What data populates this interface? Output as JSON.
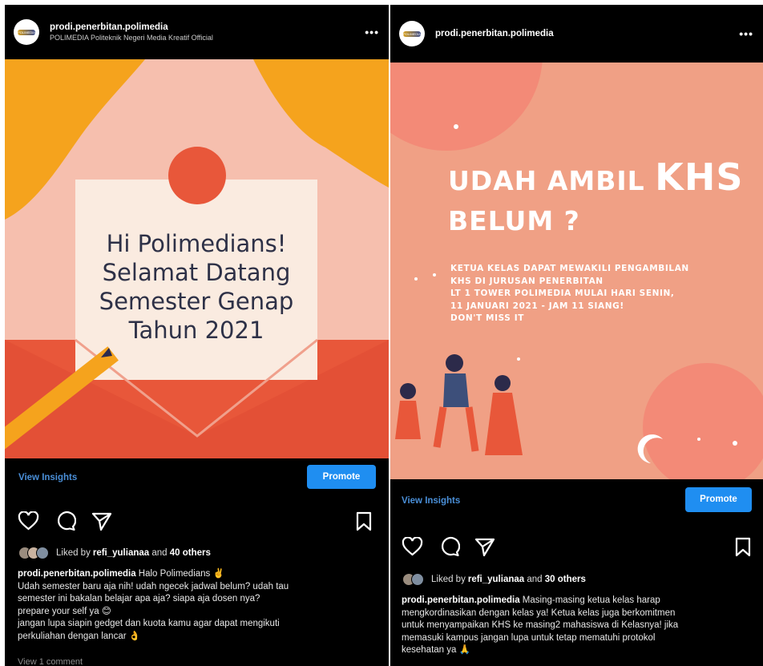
{
  "post1": {
    "username": "prodi.penerbitan.polimedia",
    "subtitle": "POLIMEDIA Politeknik Negeri Media Kreatif Official",
    "more": "•••",
    "avatar_logo": "POLIMEDIA",
    "image_lines": [
      "Hi Polimedians!",
      "Selamat Datang",
      "Semester Genap",
      "Tahun 2021"
    ],
    "view_insights": "View Insights",
    "promote": "Promote",
    "liked_prefix": "Liked by ",
    "liked_user": "refi_yulianaa",
    "liked_mid": " and ",
    "liked_others": "40 others",
    "caption_user": "prodi.penerbitan.polimedia",
    "caption_lines": [
      " Halo Polimedians ✌️",
      "Udah semester baru aja nih! udah ngecek jadwal belum? udah tau",
      "semester ini bakalan belajar apa aja? siapa aja dosen nya?",
      "prepare your self ya 😊",
      "jangan lupa siapin gedget dan kuota kamu agar dapat mengikuti",
      "perkuliahan dengan lancar 👌"
    ],
    "view_comments": "View 1 comment"
  },
  "post2": {
    "username": "prodi.penerbitan.polimedia",
    "more": "•••",
    "avatar_logo": "POLIMEDIA",
    "headline_1": "UDAH AMBIL ",
    "headline_khs": "KHS",
    "headline_2": "BELUM ?",
    "body_lines": [
      "KETUA KELAS DAPAT MEWAKILI PENGAMBILAN",
      "KHS DI JURUSAN PENERBITAN",
      "LT 1 TOWER POLIMEDIA MULAI HARI SENIN,",
      "11 JANUARI 2021 - JAM 11 SIANG!",
      "DON'T MISS IT"
    ],
    "view_insights": "View Insights",
    "promote": "Promote",
    "liked_prefix": "Liked by ",
    "liked_user": "refi_yulianaa",
    "liked_mid": " and ",
    "liked_others": "30 others",
    "caption_user": "prodi.penerbitan.polimedia",
    "caption_lines": [
      " Masing-masing ketua kelas harap",
      "mengkordinasikan dengan kelas ya! Ketua kelas juga berkomitmen",
      "untuk menyampaikan KHS ke masing2 mahasiswa di Kelasnya! jika",
      "memasuki kampus jangan lupa untuk tetap mematuhi protokol",
      "kesehatan ya 🙏"
    ]
  },
  "colors": {
    "background": "#000000",
    "link_blue": "#4a8fd8",
    "promote_blue": "#1f8ef1",
    "post1_orange": "#f5a31d",
    "post1_red": "#e8573a",
    "post2_salmon": "#f0a085"
  }
}
